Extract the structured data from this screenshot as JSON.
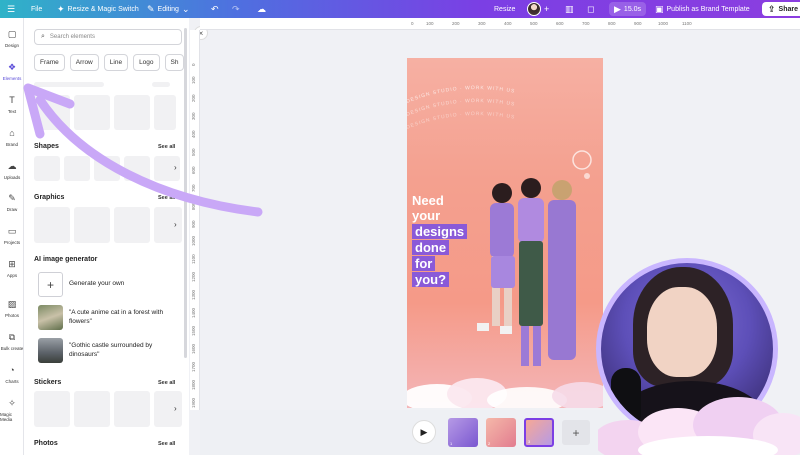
{
  "topbar": {
    "file": "File",
    "resize_magic": "Resize & Magic Switch",
    "editing": "Editing",
    "resize": "Resize",
    "timer": "15.0s",
    "publish": "Publish as Brand Template",
    "share": "Share"
  },
  "rail": [
    {
      "label": "Design",
      "icon": "design-icon"
    },
    {
      "label": "Elements",
      "icon": "elements-icon"
    },
    {
      "label": "Text",
      "icon": "text-icon"
    },
    {
      "label": "Brand",
      "icon": "brand-icon"
    },
    {
      "label": "Uploads",
      "icon": "uploads-icon"
    },
    {
      "label": "Draw",
      "icon": "draw-icon"
    },
    {
      "label": "Projects",
      "icon": "projects-icon"
    },
    {
      "label": "Apps",
      "icon": "apps-icon"
    },
    {
      "label": "Photos",
      "icon": "photos-icon"
    },
    {
      "label": "Bulk create",
      "icon": "bulk-create-icon"
    },
    {
      "label": "Charts",
      "icon": "charts-icon"
    },
    {
      "label": "Magic Media",
      "icon": "magic-media-icon"
    }
  ],
  "panel": {
    "search_placeholder": "Search elements",
    "chips": [
      "Frame",
      "Arrow",
      "Line",
      "Logo",
      "Sh"
    ],
    "shapes_title": "Shapes",
    "graphics_title": "Graphics",
    "ai_title": "AI image generator",
    "ai_items": [
      {
        "text": "Generate your own"
      },
      {
        "text": "\"A cute anime cat in a forest with flowers\""
      },
      {
        "text": "\"Gothic castle surrounded by dinosaurs\""
      }
    ],
    "stickers_title": "Stickers",
    "photos_title": "Photos",
    "see_all": "See all"
  },
  "ruler_top": [
    "0",
    "100",
    "200",
    "300",
    "400",
    "500",
    "600",
    "700",
    "800",
    "900",
    "1000",
    "1100"
  ],
  "ruler_left": [
    "0",
    "100",
    "200",
    "300",
    "400",
    "500",
    "600",
    "700",
    "800",
    "900",
    "1000",
    "1100",
    "1200",
    "1300",
    "1400",
    "1500",
    "1600",
    "1700",
    "1800",
    "1900"
  ],
  "design": {
    "arc_text": "DESIGN STUDIO · WORK WITH US",
    "headline": [
      "Need",
      "your",
      "designs",
      "done",
      "for",
      "you?"
    ]
  },
  "pages": [
    {
      "num": "1"
    },
    {
      "num": "2"
    },
    {
      "num": "3"
    }
  ],
  "colors": {
    "accent": "#7b3fe4",
    "arrow": "#c9a8f7"
  }
}
